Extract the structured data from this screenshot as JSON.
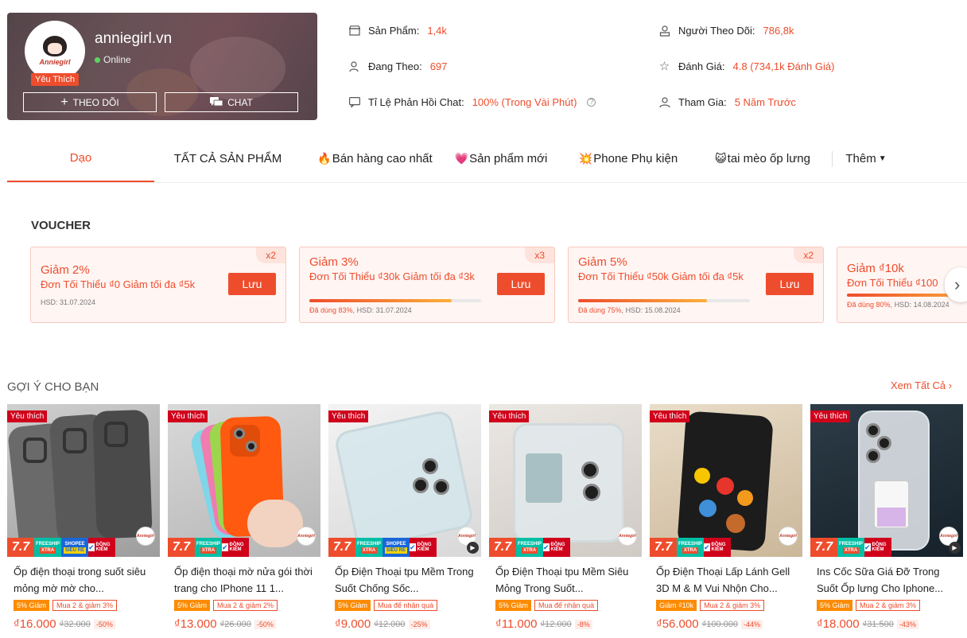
{
  "shop": {
    "name": "anniegirl.vn",
    "status": "Online",
    "badge": "Yêu Thích",
    "avatar_text": "Anniegirl",
    "follow_label": "THEO DÕI",
    "chat_label": "CHAT"
  },
  "stats": {
    "products": {
      "label": "Sản Phẩm:",
      "value": "1,4k"
    },
    "following": {
      "label": "Đang Theo:",
      "value": "697"
    },
    "response": {
      "label": "Tỉ Lệ Phản Hồi Chat:",
      "value": "100% (Trong Vài Phút)"
    },
    "followers": {
      "label": "Người Theo Dõi:",
      "value": "786,8k"
    },
    "rating": {
      "label": "Đánh Giá:",
      "value": "4.8 (734,1k Đánh Giá)"
    },
    "joined": {
      "label": "Tham Gia:",
      "value": "5 Năm Trước"
    }
  },
  "tabs": [
    {
      "label": "Dạo",
      "emoji": ""
    },
    {
      "label": "TẤT CẢ SẢN PHẨM",
      "emoji": ""
    },
    {
      "label": "Bán hàng cao nhất",
      "emoji": "🔥"
    },
    {
      "label": "Sản phẩm mới",
      "emoji": "💗"
    },
    {
      "label": "Phone Phụ kiện",
      "emoji": "💥"
    },
    {
      "label": "tai mèo ốp lưng",
      "emoji": "😺"
    },
    {
      "label": "Thêm",
      "emoji": ""
    }
  ],
  "voucher": {
    "title": "VOUCHER",
    "save_label": "Lưu",
    "items": [
      {
        "title": "Giảm 2%",
        "desc": "Đơn Tối Thiểu ₫0 Giảm tối đa ₫5k",
        "qty": "x2",
        "used_pct": null,
        "used_label": "",
        "expiry": "HSD: 31.07.2024"
      },
      {
        "title": "Giảm 3%",
        "desc": "Đơn Tối Thiểu ₫30k Giảm tối đa ₫3k",
        "qty": "x3",
        "used_pct": 83,
        "used_label": "Đã dùng 83%",
        "expiry": "HSD: 31.07.2024"
      },
      {
        "title": "Giảm 5%",
        "desc": "Đơn Tối Thiểu ₫50k Giảm tối đa ₫5k",
        "qty": "x2",
        "used_pct": 75,
        "used_label": "Đã dùng 75%",
        "expiry": "HSD: 15.08.2024"
      },
      {
        "title": "Giảm ₫10k",
        "desc": "Đơn Tối Thiểu ₫100",
        "qty": "",
        "used_pct": 80,
        "used_label": "Đã dùng 80%",
        "expiry": "HSD: 14.08.2024"
      }
    ]
  },
  "suggestions": {
    "title": "GỢI Ý CHO BẠN",
    "see_all": "Xem Tất Cả",
    "fav_label": "Yêu thích",
    "promo": {
      "sale": "7.7",
      "freeship": "FREESHIP",
      "xtra": "XTRA",
      "shopee": "SHOPEE",
      "cheap": "SIÊU RẺ",
      "check": "ĐỒNG KIỂM"
    },
    "products": [
      {
        "name": "Ốp điện thoại trong suốt siêu mỏng mờ mờ cho...",
        "discount": "5% Giảm",
        "combo": "Mua 2 & giảm 3%",
        "price": "₫16.000",
        "old_price": "₫32.000",
        "pct": "-50%",
        "cheap": true,
        "video": false
      },
      {
        "name": "Ốp điện thoại mờ nửa gói thời trang cho IPhone 11 1...",
        "discount": "5% Giảm",
        "combo": "Mua 2 & giảm 2%",
        "price": "₫13.000",
        "old_price": "₫26.000",
        "pct": "-50%",
        "cheap": false,
        "video": false
      },
      {
        "name": "Ốp Điện Thoại tpu Mềm Trong Suốt Chống Sốc...",
        "discount": "5% Giảm",
        "combo": "Mua để nhận quà",
        "price": "₫9.000",
        "old_price": "₫12.000",
        "pct": "-25%",
        "cheap": true,
        "video": true
      },
      {
        "name": "Ốp Điện Thoại tpu Mềm Siêu Mỏng Trong Suốt...",
        "discount": "5% Giảm",
        "combo": "Mua để nhận quà",
        "price": "₫11.000",
        "old_price": "₫12.000",
        "pct": "-8%",
        "cheap": false,
        "video": false
      },
      {
        "name": "Ốp Điện Thoại Lấp Lánh Gell 3D M & M Vui Nhộn Cho...",
        "discount": "Giảm ₫10k",
        "combo": "Mua 2 & giảm 3%",
        "price": "₫56.000",
        "old_price": "₫100.000",
        "pct": "-44%",
        "cheap": false,
        "video": false
      },
      {
        "name": "Ins Cốc Sữa Giá Đỡ Trong Suốt Ốp lưng Cho Iphone...",
        "discount": "5% Giảm",
        "combo": "Mua 2 & giảm 3%",
        "price": "₫18.000",
        "old_price": "₫31.500",
        "pct": "-43%",
        "cheap": false,
        "video": true
      }
    ]
  },
  "colors": {
    "accent": "#ee4d2d",
    "fav": "#d0011b",
    "discount_tag": "#fd8b00"
  }
}
